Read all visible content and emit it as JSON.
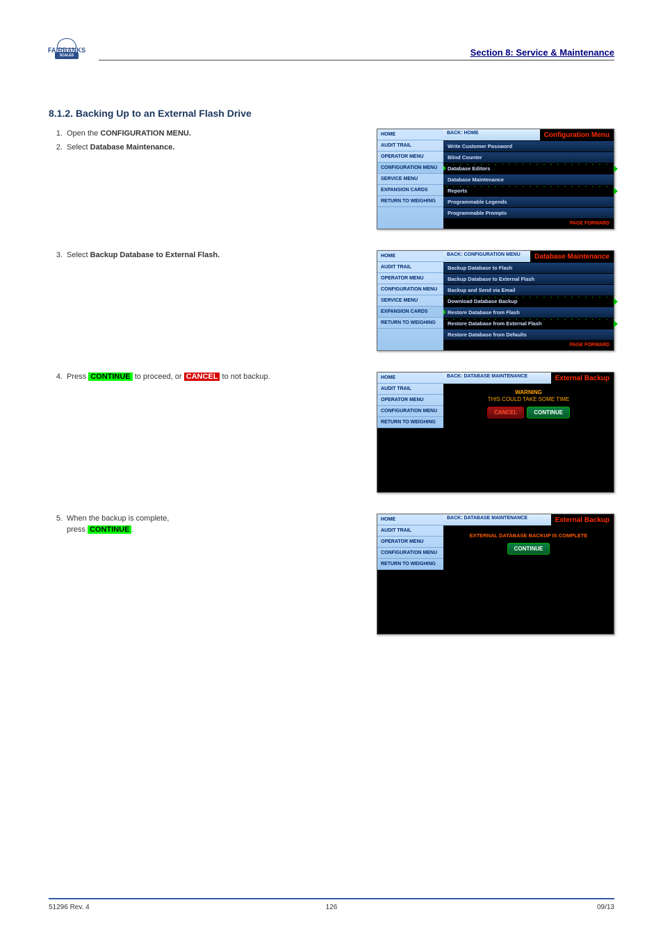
{
  "header": {
    "logo_text": "FAIRBANKS",
    "logo_sub": "SCALES",
    "section_title": "Section 8: Service & Maintenance"
  },
  "section": {
    "title": "8.1.2. Backing Up to an External Flash Drive"
  },
  "steps": {
    "s1": {
      "num": "1.",
      "pre": "Open the",
      "bold": "CONFIGURATION MENU.",
      "post": ""
    },
    "s2": {
      "num": "2.",
      "pre": "Select",
      "bold": "Database Maintenance.",
      "post": ""
    },
    "s3": {
      "num": "3.",
      "pre": "Select",
      "bold": "Backup Database to External Flash.",
      "post": ""
    },
    "s4": {
      "num": "4.",
      "pre": "Press ",
      "btn_continue": "CONTINUE",
      "mid": " to proceed, or ",
      "btn_cancel": "CANCEL",
      "post": " to not backup."
    },
    "s5": {
      "num": "5.",
      "line1_pre": "When the backup is complete,",
      "line2_pre": "press",
      "btn_continue": "CONTINUE",
      "post": "."
    }
  },
  "nav_items": [
    "HOME",
    "AUDIT TRAIL",
    "OPERATOR MENU",
    "CONFIGURATION MENU",
    "SERVICE MENU",
    "EXPANSION CARDS",
    "RETURN TO WEIGHING"
  ],
  "nav_items_short": [
    "HOME",
    "AUDIT TRAIL",
    "OPERATOR MENU",
    "CONFIGURATION MENU",
    "RETURN TO WEIGHING"
  ],
  "panel1": {
    "back": "BACK: HOME",
    "title": "Configuration Menu",
    "items": [
      "Write Customer Password",
      "Blind Counter",
      "Database Editors",
      "Database Maintenance",
      "Reports",
      "Programmable Legends",
      "Programmable Prompts"
    ],
    "pagefwd": "PAGE FORWARD"
  },
  "panel2": {
    "back": "BACK: CONFIGURATION MENU",
    "title": "Database Maintenance",
    "items": [
      "Backup Database to Flash",
      "Backup Database to External Flash",
      "Backup and Send via Email",
      "Download Database Backup",
      "Restore Database from Flash",
      "Restore Database from External Flash",
      "Restore Database from Defaults"
    ],
    "pagefwd": "PAGE FORWARD"
  },
  "panel3": {
    "back": "BACK: DATABASE MAINTENANCE",
    "title": "External Backup",
    "warn_t": "WARNING",
    "warn_s": "THIS COULD TAKE SOME TIME",
    "btn_cancel": "CANCEL",
    "btn_continue": "CONTINUE"
  },
  "panel4": {
    "back": "BACK: DATABASE MAINTENANCE",
    "title": "External Backup",
    "msg": "EXTERNAL DATABASE BACKUP IS COMPLETE",
    "btn_continue": "CONTINUE"
  },
  "footer": {
    "left": "51296 Rev. 4",
    "center": "126",
    "right": "09/13"
  }
}
